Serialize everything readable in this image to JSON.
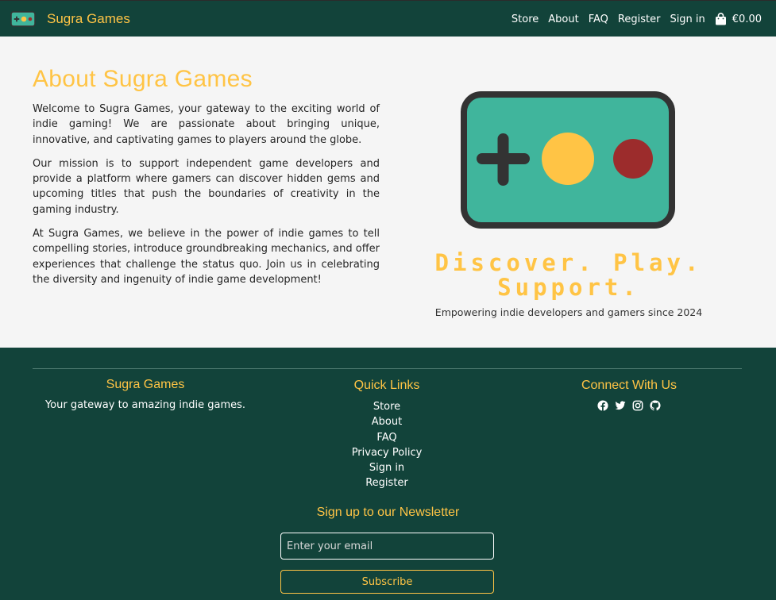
{
  "nav": {
    "brand_name": "Sugra Games",
    "links": [
      "Store",
      "About",
      "FAQ",
      "Register",
      "Sign in"
    ],
    "cart_total": "€0.00"
  },
  "about": {
    "title": "About Sugra Games",
    "paragraphs": [
      "Welcome to Sugra Games, your gateway to the exciting world of indie gaming! We are passionate about bringing unique, innovative, and captivating games to players around the globe.",
      "Our mission is to support independent game developers and provide a platform where gamers can discover hidden gems and upcoming titles that push the boundaries of creativity in the gaming industry.",
      "At Sugra Games, we believe in the power of indie games to tell compelling stories, introduce groundbreaking mechanics, and offer experiences that challenge the status quo. Join us in celebrating the diversity and ingenuity of indie game development!"
    ],
    "tagline_line1": "Discover. Play.",
    "tagline_line2": "Support.",
    "subtagline": "Empowering indie developers and gamers since 2024"
  },
  "footer": {
    "brand_title": "Sugra Games",
    "brand_text": "Your gateway to amazing indie games.",
    "links_title": "Quick Links",
    "links": [
      "Store",
      "About",
      "FAQ",
      "Privacy Policy",
      "Sign in",
      "Register"
    ],
    "social_title": "Connect With Us",
    "social_icons": [
      "facebook-icon",
      "twitter-icon",
      "instagram-icon",
      "github-icon"
    ],
    "newsletter_title": "Sign up to our Newsletter",
    "email_placeholder": "Enter your email",
    "subscribe_label": "Subscribe"
  },
  "colors": {
    "primary": "#12433a",
    "accent": "#ffc445",
    "teal": "#40b59c",
    "red": "#9c2c2c",
    "dark": "#333333",
    "background": "#f5f5f5"
  }
}
